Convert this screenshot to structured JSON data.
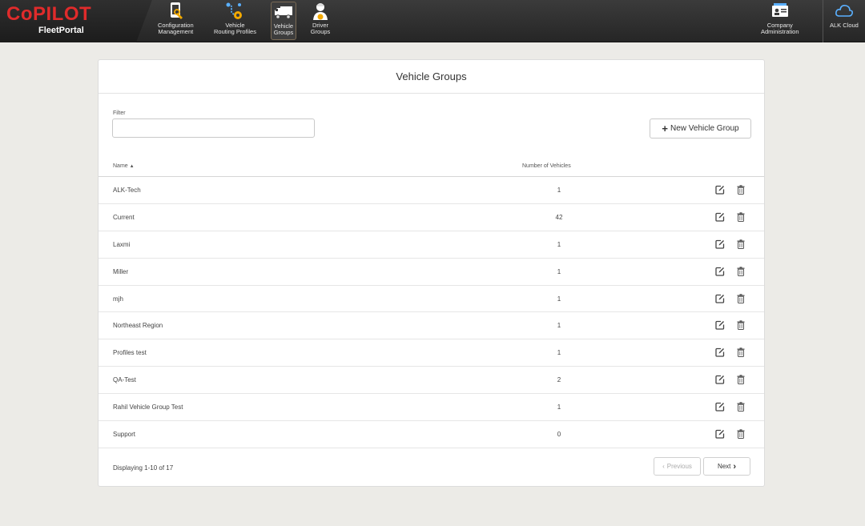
{
  "brand": {
    "logo": "CoPILOT",
    "sub": "FleetPortal"
  },
  "nav": {
    "config": [
      "Configuration",
      "Management"
    ],
    "routing": [
      "Vehicle",
      "Routing Profiles"
    ],
    "vehicle_groups": [
      "Vehicle",
      "Groups"
    ],
    "driver_groups": [
      "Driver",
      "Groups"
    ],
    "company_admin": [
      "Company",
      "Administration"
    ],
    "cloud": "ALK Cloud"
  },
  "page": {
    "title": "Vehicle Groups",
    "filter_label": "Filter",
    "filter_value": "",
    "new_button": "New Vehicle Group",
    "columns": {
      "name": "Name",
      "sort_icon": "▲",
      "count": "Number of Vehicles"
    },
    "rows": [
      {
        "name": "ALK-Tech",
        "count": "1"
      },
      {
        "name": "Current",
        "count": "42"
      },
      {
        "name": "Laxmi",
        "count": "1"
      },
      {
        "name": "Miller",
        "count": "1"
      },
      {
        "name": "mjh",
        "count": "1"
      },
      {
        "name": "Northeast Region",
        "count": "1"
      },
      {
        "name": "Profiles test",
        "count": "1"
      },
      {
        "name": "QA-Test",
        "count": "2"
      },
      {
        "name": "Rahil Vehicle Group Test",
        "count": "1"
      },
      {
        "name": "Support",
        "count": "0"
      }
    ],
    "footer": "Displaying 1-10 of 17",
    "prev": "Previous",
    "next": "Next"
  },
  "colors": {
    "accent_red": "#e02b2b",
    "nav_bg": "#2a2a2a",
    "page_bg": "#ecebe7"
  }
}
